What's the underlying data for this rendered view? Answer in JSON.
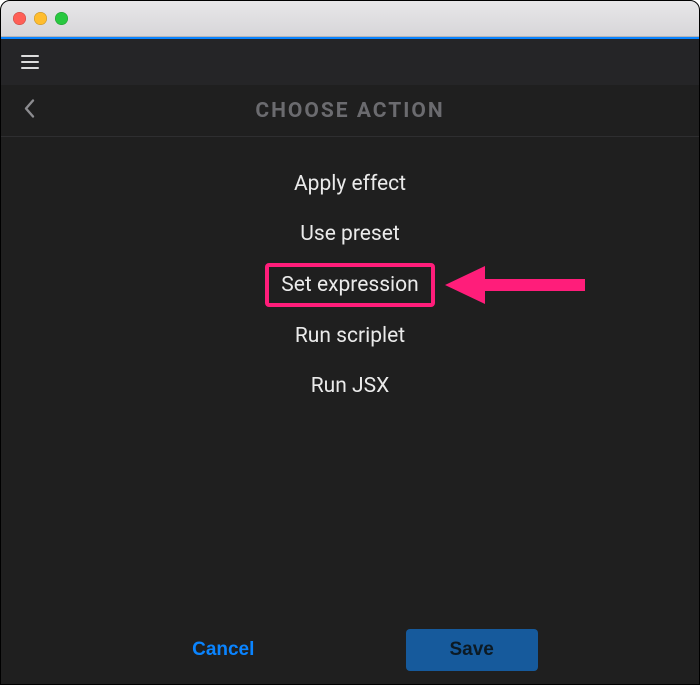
{
  "header": {
    "title": "CHOOSE ACTION"
  },
  "actions": [
    {
      "label": "Apply effect"
    },
    {
      "label": "Use preset"
    },
    {
      "label": "Set expression",
      "highlighted": true
    },
    {
      "label": "Run scriplet"
    },
    {
      "label": "Run JSX"
    }
  ],
  "footer": {
    "cancel": "Cancel",
    "save": "Save"
  },
  "annotation": {
    "highlight_color": "#ff1d7a"
  }
}
